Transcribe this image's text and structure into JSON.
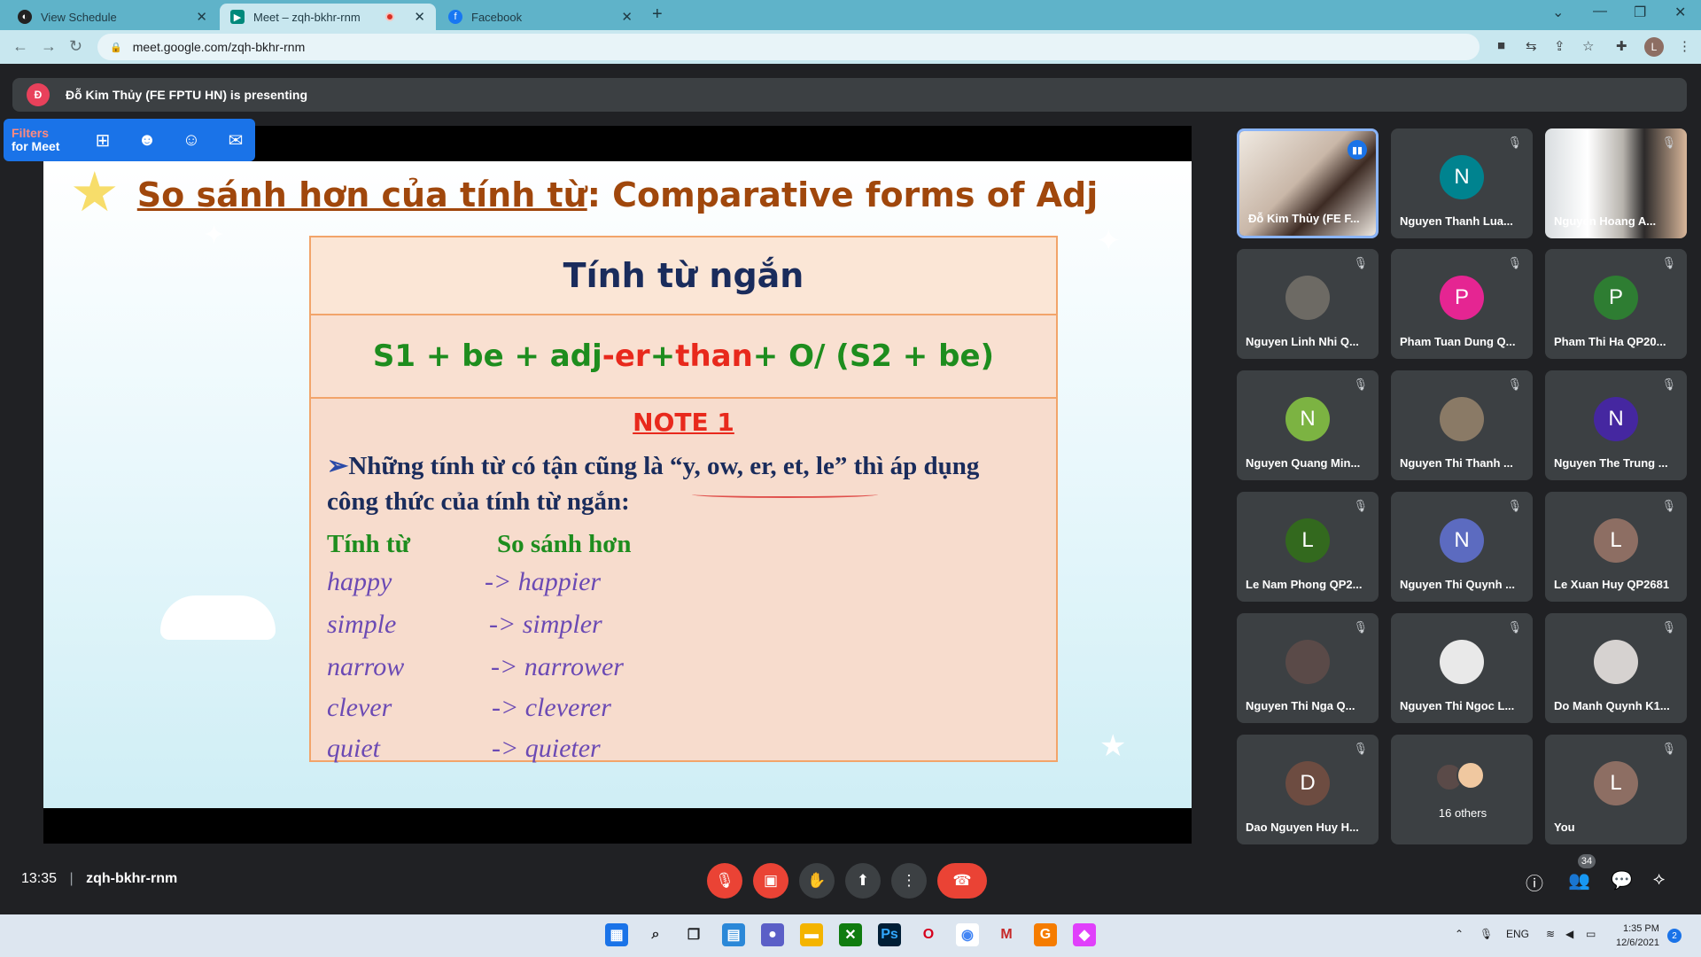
{
  "browser": {
    "tabs": [
      {
        "title": "View Schedule",
        "icon": "app-icon"
      },
      {
        "title": "Meet – zqh-bkhr-rnm",
        "icon": "meet-icon"
      },
      {
        "title": "Facebook",
        "icon": "facebook-icon"
      }
    ],
    "url": "meet.google.com/zqh-bkhr-rnm",
    "profile_initial": "L"
  },
  "meet": {
    "presenting_initial": "Đ",
    "presenting_text": "Đỗ Kim Thủy (FE FPTU HN) is presenting",
    "filters_ext": {
      "line1": "Filters",
      "line2": "for Meet"
    },
    "meeting_code": "zqh-bkhr-rnm",
    "time": "13:35",
    "participant_count": "34"
  },
  "slide": {
    "title_vi": "So sánh hơn của tính từ",
    "title_en": ": Comparative forms of Adj",
    "row1": "Tính từ ngắn",
    "formula": {
      "a": "S1 + be + adj ",
      "b": "-er",
      "c": " + ",
      "d": "than",
      "e": " + O/ (S2 + be)"
    },
    "note_title": "NOTE 1",
    "note_arrow": "➢",
    "note_text": "Những tính từ có tận cũng là “y, ow, er, et, le” thì áp dụng công thức của tính từ ngắn:",
    "col1": "Tính từ",
    "col2": "So sánh hơn",
    "words": [
      {
        "a": "happy",
        "b": "-> happier"
      },
      {
        "a": "simple",
        "b": "-> simpler"
      },
      {
        "a": "narrow",
        "b": "-> narrower"
      },
      {
        "a": "clever",
        "b": "-> cleverer"
      },
      {
        "a": "quiet",
        "b": "-> quieter"
      }
    ]
  },
  "participants": [
    {
      "name": "Đỗ Kim Thủy (FE F...",
      "initial": "",
      "color": "",
      "kind": "video1"
    },
    {
      "name": "Nguyen Thanh Lua...",
      "initial": "N",
      "color": "#00838f",
      "kind": "letter"
    },
    {
      "name": "Nguyen Hoang A...",
      "initial": "",
      "color": "",
      "kind": "video2"
    },
    {
      "name": "Nguyen Linh Nhi Q...",
      "initial": "",
      "color": "#6d6a64",
      "kind": "photo"
    },
    {
      "name": "Pham Tuan Dung Q...",
      "initial": "P",
      "color": "#e52592",
      "kind": "letter"
    },
    {
      "name": "Pham Thi Ha QP20...",
      "initial": "P",
      "color": "#2e7d32",
      "kind": "letter"
    },
    {
      "name": "Nguyen Quang Min...",
      "initial": "N",
      "color": "#7cb342",
      "kind": "letter"
    },
    {
      "name": "Nguyen Thi Thanh ...",
      "initial": "",
      "color": "#8a7a66",
      "kind": "photo"
    },
    {
      "name": "Nguyen The Trung ...",
      "initial": "N",
      "color": "#4527a0",
      "kind": "letter"
    },
    {
      "name": "Le Nam Phong QP2...",
      "initial": "L",
      "color": "#33691e",
      "kind": "letter"
    },
    {
      "name": "Nguyen Thi Quynh ...",
      "initial": "N",
      "color": "#5c6bc0",
      "kind": "letter"
    },
    {
      "name": "Le Xuan Huy QP2681",
      "initial": "L",
      "color": "#8d6e63",
      "kind": "letter"
    },
    {
      "name": "Nguyen Thi Nga Q...",
      "initial": "",
      "color": "#5a4a48",
      "kind": "photo"
    },
    {
      "name": "Nguyen Thi Ngoc L...",
      "initial": "",
      "color": "#e9e9e9",
      "kind": "photo"
    },
    {
      "name": "Do Manh Quynh K1...",
      "initial": "",
      "color": "#d6d2d0",
      "kind": "photo"
    },
    {
      "name": "Dao Nguyen Huy H...",
      "initial": "D",
      "color": "#6d4c41",
      "kind": "letter"
    },
    {
      "name": "16 others",
      "initial": "",
      "color": "",
      "kind": "others"
    },
    {
      "name": "You",
      "initial": "L",
      "color": "#8d6e63",
      "kind": "letter"
    }
  ],
  "taskbar": {
    "lang": "ENG",
    "time": "1:35 PM",
    "date": "12/6/2021",
    "notifications": "2"
  }
}
